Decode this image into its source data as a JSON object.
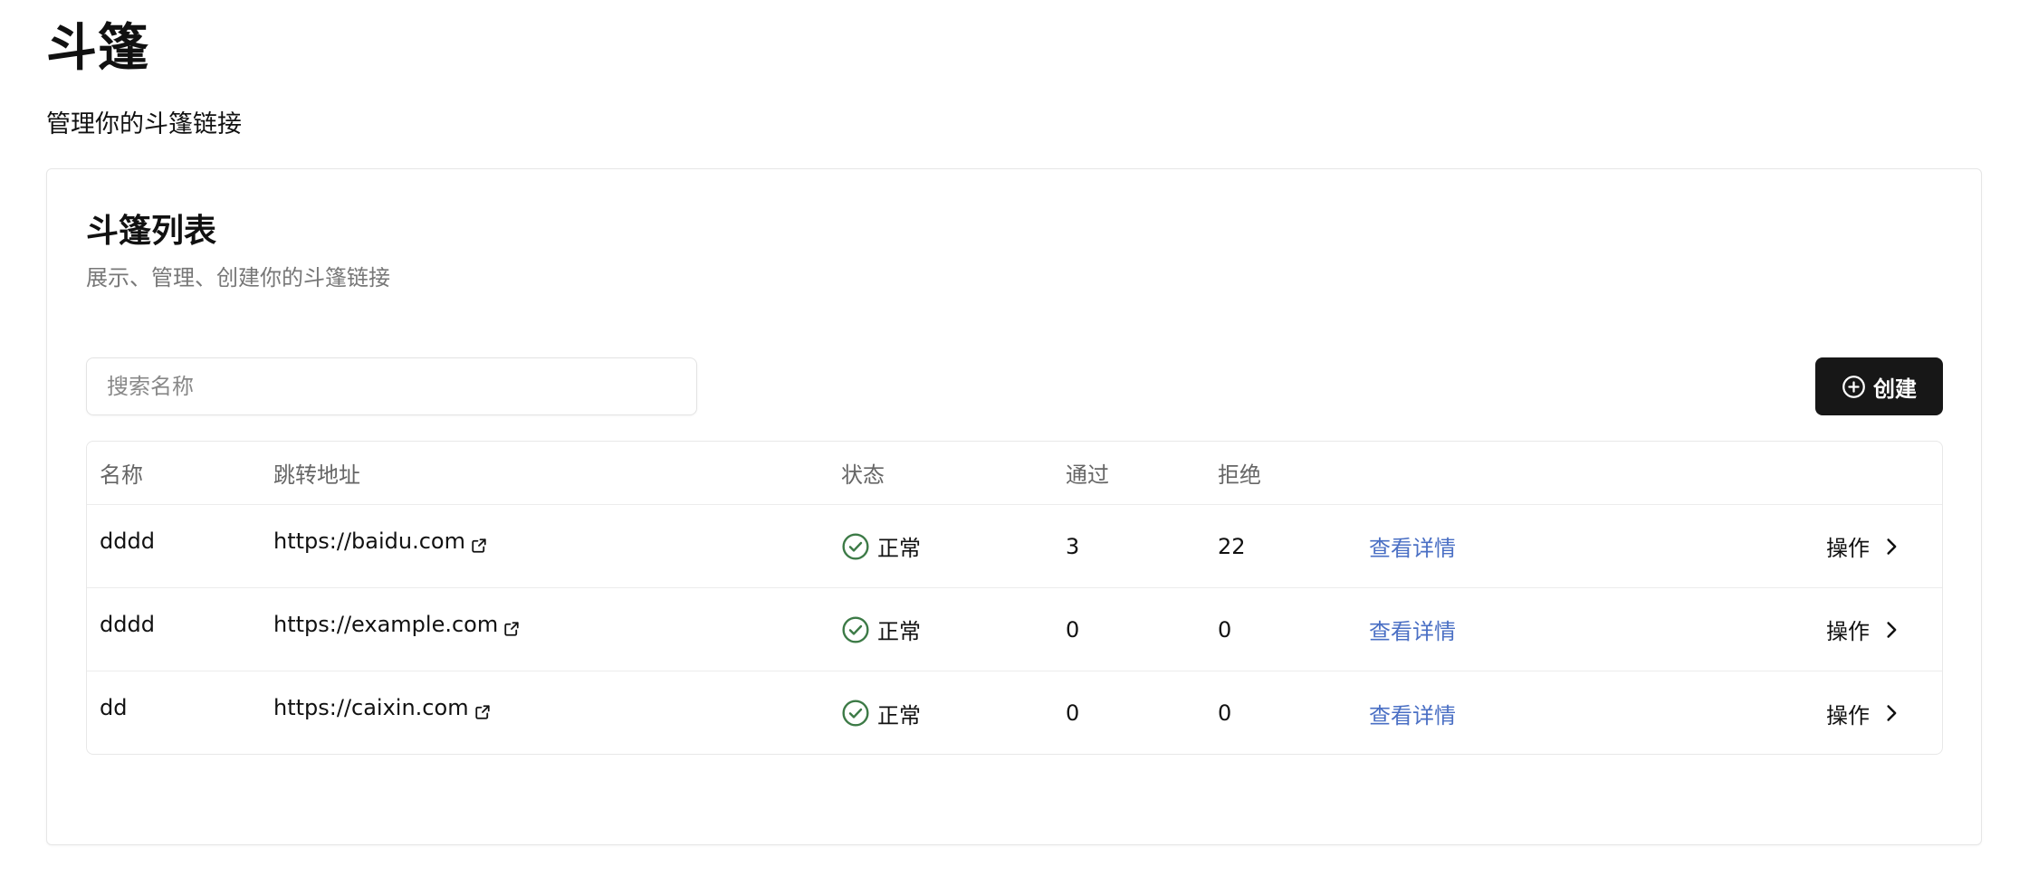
{
  "page": {
    "title": "斗篷",
    "subtitle": "管理你的斗篷链接"
  },
  "card": {
    "title": "斗篷列表",
    "description": "展示、管理、创建你的斗篷链接"
  },
  "search": {
    "placeholder": "搜索名称",
    "value": ""
  },
  "create_button": {
    "label": "创建",
    "icon": "plus-circle-icon"
  },
  "table": {
    "columns": [
      "名称",
      "跳转地址",
      "状态",
      "通过",
      "拒绝"
    ],
    "rows": [
      {
        "name": "dddd",
        "url": "https://baidu.com",
        "status": "正常",
        "pass": "3",
        "reject": "22",
        "detail": "查看详情",
        "action": "操作"
      },
      {
        "name": "dddd",
        "url": "https://example.com",
        "status": "正常",
        "pass": "0",
        "reject": "0",
        "detail": "查看详情",
        "action": "操作"
      },
      {
        "name": "dd",
        "url": "https://caixin.com",
        "status": "正常",
        "pass": "0",
        "reject": "0",
        "detail": "查看详情",
        "action": "操作"
      }
    ]
  },
  "colors": {
    "status_ok": "#3c7a46",
    "link": "#4a6fc4",
    "primary_button": "#171717"
  }
}
